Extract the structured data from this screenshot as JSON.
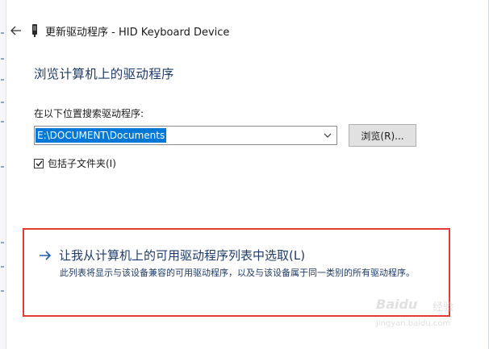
{
  "window": {
    "title": "更新驱动程序 - HID Keyboard Device"
  },
  "heading": "浏览计算机上的驱动程序",
  "search": {
    "label": "在以下位置搜索驱动程序:",
    "path_value": "E:\\DOCUMENT\\Documents",
    "browse_label": "浏览(R)..."
  },
  "include_subfolders": {
    "label": "包括子文件夹(I)",
    "checked": true
  },
  "pick": {
    "link_label": "让我从计算机上的可用驱动程序列表中选取(L)",
    "description": "此列表将显示与该设备兼容的可用驱动程序，以及与该设备属于同一类别的所有驱动程序。"
  },
  "watermark": {
    "brand": "Baidu",
    "brand_cn": "经验",
    "url": "jingyan.baidu.com"
  },
  "colors": {
    "accent": "#0078d7",
    "heading": "#1f3b6b",
    "highlight_border": "#e53935"
  },
  "icons": {
    "back": "arrow-left-icon",
    "device": "keyboard-device-icon",
    "dropdown": "chevron-down-icon",
    "link_arrow": "arrow-right-icon",
    "checkbox": "checkmark-icon"
  }
}
